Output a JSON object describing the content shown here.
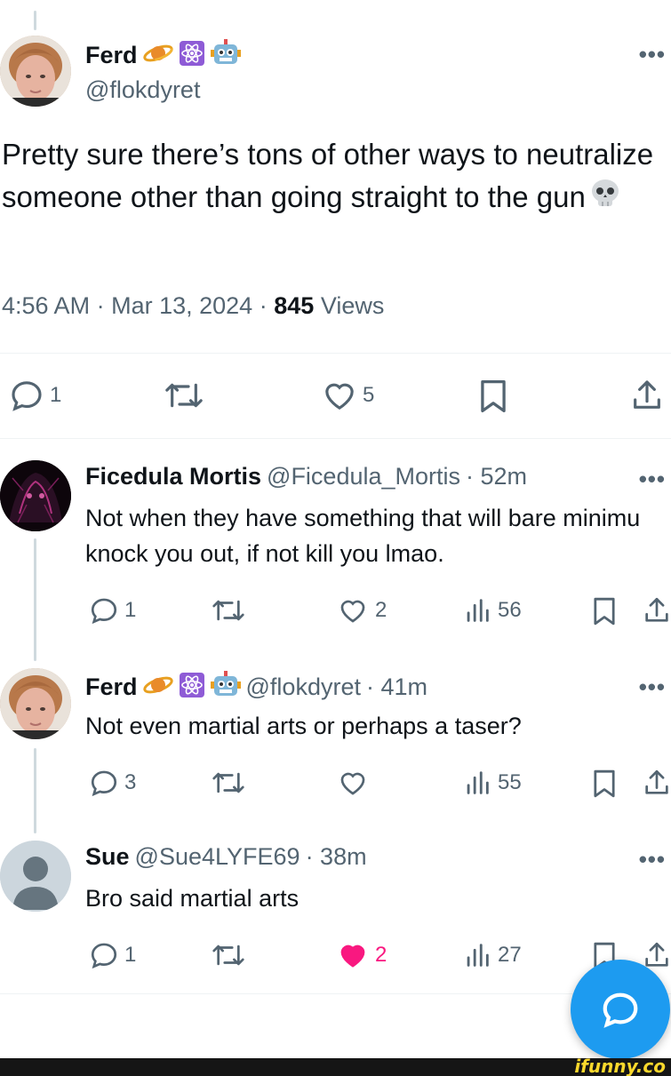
{
  "main_tweet": {
    "author_name": "Ferd",
    "author_handle": "@flokdyret",
    "text": "Pretty sure there’s tons of other ways to neutralize someone other than going straight to the gun",
    "time": "4:56 AM",
    "date": "Mar 13, 2024",
    "views_count": "845",
    "views_label": "Views",
    "separator": "·",
    "reply_count": "1",
    "like_count": "5",
    "icons": [
      "planet-emoji",
      "atom-emoji",
      "robot-emoji",
      "skull-emoji"
    ]
  },
  "replies": [
    {
      "author_name": "Ficedula Mortis",
      "author_handle": "@Ficedula_Mortis",
      "time": "· 52m",
      "text": "Not when they have something that will bare minimu knock you out, if not kill you lmao.",
      "reply_count": "1",
      "like_count": "2",
      "liked": false,
      "views": "56"
    },
    {
      "author_name": "Ferd",
      "author_handle": "@flokdyret",
      "time": "· 41m",
      "text": "Not even martial arts or perhaps a taser?",
      "reply_count": "3",
      "like_count": "",
      "liked": false,
      "views": "55"
    },
    {
      "author_name": "Sue",
      "author_handle": "@Sue4LYFE69",
      "time": "· 38m",
      "text": "Bro said martial arts",
      "reply_count": "1",
      "like_count": "2",
      "liked": true,
      "views": "27"
    }
  ],
  "more_label": "•••",
  "watermark": "ifunny.co",
  "colors": {
    "accent": "#1d9bf0",
    "like_active": "#f91880",
    "muted": "#536471",
    "text": "#0f1419"
  }
}
